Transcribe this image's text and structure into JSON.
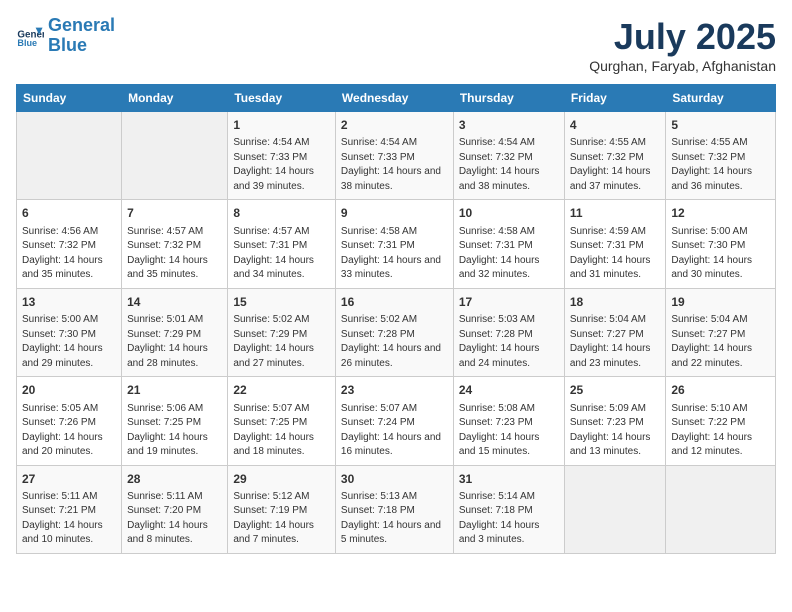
{
  "logo": {
    "line1": "General",
    "line2": "Blue"
  },
  "title": "July 2025",
  "subtitle": "Qurghan, Faryab, Afghanistan",
  "days_of_week": [
    "Sunday",
    "Monday",
    "Tuesday",
    "Wednesday",
    "Thursday",
    "Friday",
    "Saturday"
  ],
  "weeks": [
    [
      {
        "day": "",
        "info": ""
      },
      {
        "day": "",
        "info": ""
      },
      {
        "day": "1",
        "info": "Sunrise: 4:54 AM\nSunset: 7:33 PM\nDaylight: 14 hours and 39 minutes."
      },
      {
        "day": "2",
        "info": "Sunrise: 4:54 AM\nSunset: 7:33 PM\nDaylight: 14 hours and 38 minutes."
      },
      {
        "day": "3",
        "info": "Sunrise: 4:54 AM\nSunset: 7:32 PM\nDaylight: 14 hours and 38 minutes."
      },
      {
        "day": "4",
        "info": "Sunrise: 4:55 AM\nSunset: 7:32 PM\nDaylight: 14 hours and 37 minutes."
      },
      {
        "day": "5",
        "info": "Sunrise: 4:55 AM\nSunset: 7:32 PM\nDaylight: 14 hours and 36 minutes."
      }
    ],
    [
      {
        "day": "6",
        "info": "Sunrise: 4:56 AM\nSunset: 7:32 PM\nDaylight: 14 hours and 35 minutes."
      },
      {
        "day": "7",
        "info": "Sunrise: 4:57 AM\nSunset: 7:32 PM\nDaylight: 14 hours and 35 minutes."
      },
      {
        "day": "8",
        "info": "Sunrise: 4:57 AM\nSunset: 7:31 PM\nDaylight: 14 hours and 34 minutes."
      },
      {
        "day": "9",
        "info": "Sunrise: 4:58 AM\nSunset: 7:31 PM\nDaylight: 14 hours and 33 minutes."
      },
      {
        "day": "10",
        "info": "Sunrise: 4:58 AM\nSunset: 7:31 PM\nDaylight: 14 hours and 32 minutes."
      },
      {
        "day": "11",
        "info": "Sunrise: 4:59 AM\nSunset: 7:31 PM\nDaylight: 14 hours and 31 minutes."
      },
      {
        "day": "12",
        "info": "Sunrise: 5:00 AM\nSunset: 7:30 PM\nDaylight: 14 hours and 30 minutes."
      }
    ],
    [
      {
        "day": "13",
        "info": "Sunrise: 5:00 AM\nSunset: 7:30 PM\nDaylight: 14 hours and 29 minutes."
      },
      {
        "day": "14",
        "info": "Sunrise: 5:01 AM\nSunset: 7:29 PM\nDaylight: 14 hours and 28 minutes."
      },
      {
        "day": "15",
        "info": "Sunrise: 5:02 AM\nSunset: 7:29 PM\nDaylight: 14 hours and 27 minutes."
      },
      {
        "day": "16",
        "info": "Sunrise: 5:02 AM\nSunset: 7:28 PM\nDaylight: 14 hours and 26 minutes."
      },
      {
        "day": "17",
        "info": "Sunrise: 5:03 AM\nSunset: 7:28 PM\nDaylight: 14 hours and 24 minutes."
      },
      {
        "day": "18",
        "info": "Sunrise: 5:04 AM\nSunset: 7:27 PM\nDaylight: 14 hours and 23 minutes."
      },
      {
        "day": "19",
        "info": "Sunrise: 5:04 AM\nSunset: 7:27 PM\nDaylight: 14 hours and 22 minutes."
      }
    ],
    [
      {
        "day": "20",
        "info": "Sunrise: 5:05 AM\nSunset: 7:26 PM\nDaylight: 14 hours and 20 minutes."
      },
      {
        "day": "21",
        "info": "Sunrise: 5:06 AM\nSunset: 7:25 PM\nDaylight: 14 hours and 19 minutes."
      },
      {
        "day": "22",
        "info": "Sunrise: 5:07 AM\nSunset: 7:25 PM\nDaylight: 14 hours and 18 minutes."
      },
      {
        "day": "23",
        "info": "Sunrise: 5:07 AM\nSunset: 7:24 PM\nDaylight: 14 hours and 16 minutes."
      },
      {
        "day": "24",
        "info": "Sunrise: 5:08 AM\nSunset: 7:23 PM\nDaylight: 14 hours and 15 minutes."
      },
      {
        "day": "25",
        "info": "Sunrise: 5:09 AM\nSunset: 7:23 PM\nDaylight: 14 hours and 13 minutes."
      },
      {
        "day": "26",
        "info": "Sunrise: 5:10 AM\nSunset: 7:22 PM\nDaylight: 14 hours and 12 minutes."
      }
    ],
    [
      {
        "day": "27",
        "info": "Sunrise: 5:11 AM\nSunset: 7:21 PM\nDaylight: 14 hours and 10 minutes."
      },
      {
        "day": "28",
        "info": "Sunrise: 5:11 AM\nSunset: 7:20 PM\nDaylight: 14 hours and 8 minutes."
      },
      {
        "day": "29",
        "info": "Sunrise: 5:12 AM\nSunset: 7:19 PM\nDaylight: 14 hours and 7 minutes."
      },
      {
        "day": "30",
        "info": "Sunrise: 5:13 AM\nSunset: 7:18 PM\nDaylight: 14 hours and 5 minutes."
      },
      {
        "day": "31",
        "info": "Sunrise: 5:14 AM\nSunset: 7:18 PM\nDaylight: 14 hours and 3 minutes."
      },
      {
        "day": "",
        "info": ""
      },
      {
        "day": "",
        "info": ""
      }
    ]
  ]
}
